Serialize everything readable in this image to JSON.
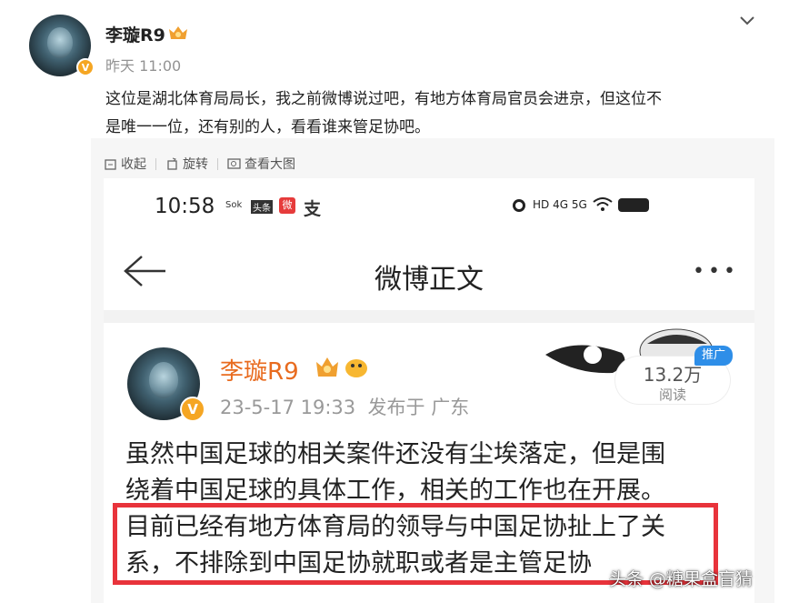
{
  "post": {
    "author": "李璇R9",
    "time": "昨天 11:00",
    "verified_badge": "V",
    "text_line1": "这位是湖北体育局局长，我之前微博说过吧，有地方体育局官员会进京，但这位不",
    "text_line2": "是唯一一位，还有别的人，看看谁来管足协吧。"
  },
  "toolbar": {
    "collapse_label": "收起",
    "rotate_label": "旋转",
    "view_large_label": "查看大图"
  },
  "screenshot": {
    "status_time": "10:58",
    "status_small1": "Sok",
    "status_small2": "头条",
    "status_red_icon": "微",
    "status_zhi": "支",
    "status_right": "HD 4G 5G",
    "nav_title": "微博正文",
    "more_label": "•••",
    "author": "李璇R9",
    "post_time": "23-5-17 19:33",
    "post_location": "发布于 广东",
    "verified_badge": "V",
    "reads_count": "13.2万",
    "reads_label": "阅读",
    "promo_label": "推广",
    "body_line1": "虽然中国足球的相关案件还没有尘埃落定，但是围",
    "body_line2": "绕着中国足球的具体工作，相关的工作也在开展。",
    "body_line3": "目前已经有地方体育局的领导与中国足协扯上了关",
    "body_line4": "系，不排除到中国足协就职或者是主管足协"
  },
  "watermark": "头条 @糖果盒盲猜",
  "colors": {
    "author_orange": "#e86b1f",
    "highlight_red": "#e8333b",
    "promo_blue": "#2e8ee8",
    "verified_gold": "#f5a623"
  }
}
